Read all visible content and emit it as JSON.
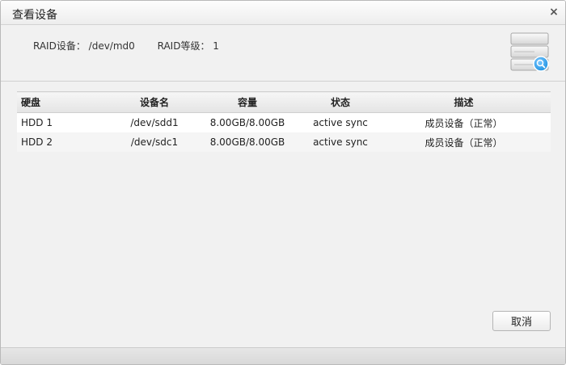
{
  "dialog": {
    "title": "查看设备",
    "close_symbol": "×"
  },
  "info": {
    "raid_device": "RAID设备： /dev/md0",
    "raid_level": "RAID等级： 1"
  },
  "icon": {
    "name": "disk-stack-search-icon"
  },
  "table": {
    "columns": [
      "硬盘",
      "设备名",
      "容量",
      "状态",
      "描述"
    ],
    "rows": [
      [
        "HDD 1",
        "/dev/sdd1",
        "8.00GB/8.00GB",
        "active sync",
        "成员设备（正常）"
      ],
      [
        "HDD 2",
        "/dev/sdc1",
        "8.00GB/8.00GB",
        "active sync",
        "成员设备（正常）"
      ]
    ]
  },
  "buttons": {
    "cancel": "取消"
  },
  "colors": {
    "accent_blue": "#1a8fe0",
    "panel_bg": "#f1f1f1"
  }
}
